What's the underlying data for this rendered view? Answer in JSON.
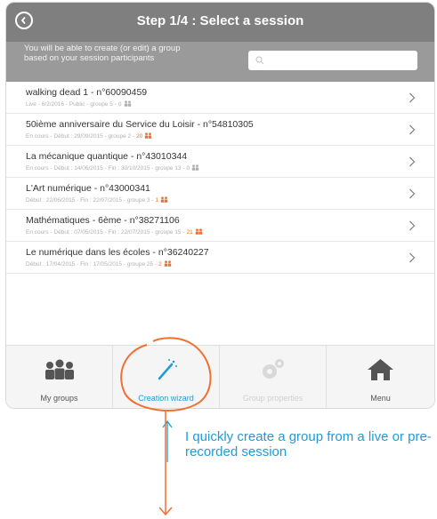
{
  "header": {
    "title": "Step 1/4 : Select a session"
  },
  "subbar": {
    "info": "You will be able to create (or edit) a group based on your session participants",
    "search_placeholder": ""
  },
  "sessions": [
    {
      "title": "walking dead 1 - n°60090459",
      "meta": "Live - 6/2/2016 - Public - groupe 5 -",
      "count": "0",
      "count_color": "grey"
    },
    {
      "title": "50ième anniversaire du Service du Loisir - n°54810305",
      "meta": "En cours - Début : 29/09/2015 - groupe 2 -",
      "count": "20",
      "count_color": "orange"
    },
    {
      "title": "La mécanique quantique - n°43010344",
      "meta": "En cours - Début : 14/06/2015 - Fin : 30/10/2015 - groupe 13 -",
      "count": "0",
      "count_color": "grey"
    },
    {
      "title": "L'Art numérique - n°43000341",
      "meta": "Début : 22/06/2015 - Fin : 22/07/2015 - groupe 3 -",
      "count": "1",
      "count_color": "orange"
    },
    {
      "title": "Mathématiques - 6ème - n°38271106",
      "meta": "En cours - Début : 07/05/2015 - Fin : 22/07/2015 - groupe 15 -",
      "count": "21",
      "count_color": "orange"
    },
    {
      "title": "Le numérique dans les écoles - n°36240227",
      "meta": "Début : 17/04/2015 - Fin : 17/05/2015 - groupe 25 -",
      "count": "2",
      "count_color": "orange"
    }
  ],
  "tabs": {
    "my_groups": "My groups",
    "creation_wizard": "Creation wizard",
    "group_properties": "Group properties",
    "menu": "Menu"
  },
  "annotation": {
    "text": "I quickly create a group from a live or pre-recorded session"
  },
  "colors": {
    "accent": "#1f9bd8",
    "highlight": "#f07030",
    "header": "#7f7f7f"
  }
}
